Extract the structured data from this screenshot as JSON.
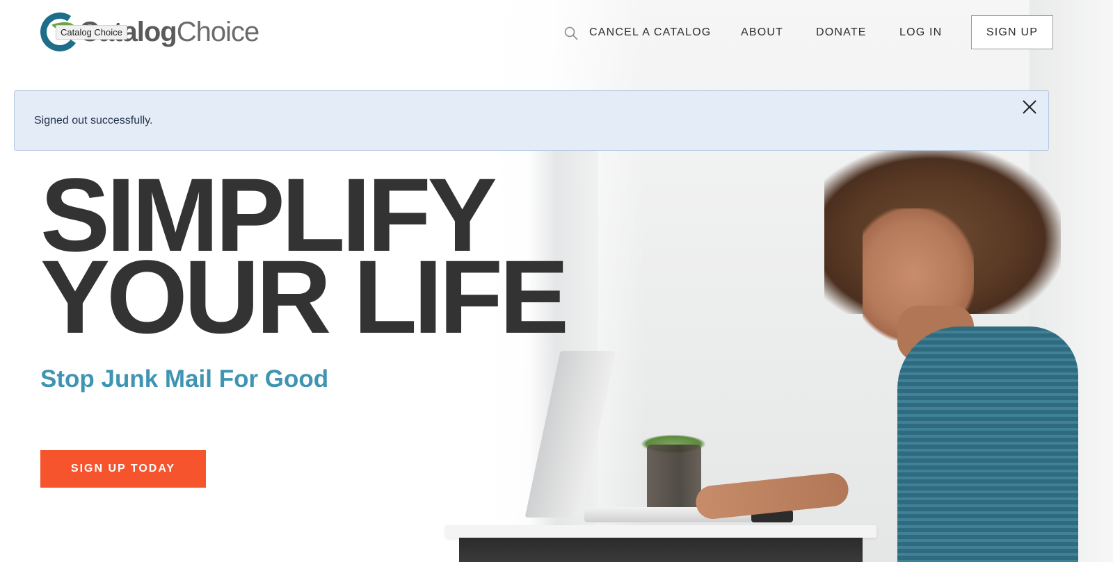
{
  "brand": {
    "logo_text_bold": "Catalog",
    "logo_text_regular": "Choice",
    "tooltip": "Catalog Choice"
  },
  "nav": {
    "search_icon": "search-icon",
    "cancel_catalog": "CANCEL A CATALOG",
    "about": "ABOUT",
    "donate": "DONATE",
    "log_in": "LOG IN",
    "sign_up": "SIGN UP"
  },
  "alert": {
    "message": "Signed out successfully.",
    "close_icon": "close-icon"
  },
  "hero": {
    "headline_line1": "SIMPLIFY",
    "headline_line2": "YOUR LIFE",
    "subheadline": "Stop Junk Mail For Good",
    "cta": "SIGN UP TODAY"
  },
  "colors": {
    "brand_teal": "#1e6e8a",
    "brand_green": "#6fa24a",
    "subhead_blue": "#3f94b2",
    "cta_orange": "#f5542d",
    "alert_bg": "#e3ecf7",
    "headline_text": "#333333"
  }
}
